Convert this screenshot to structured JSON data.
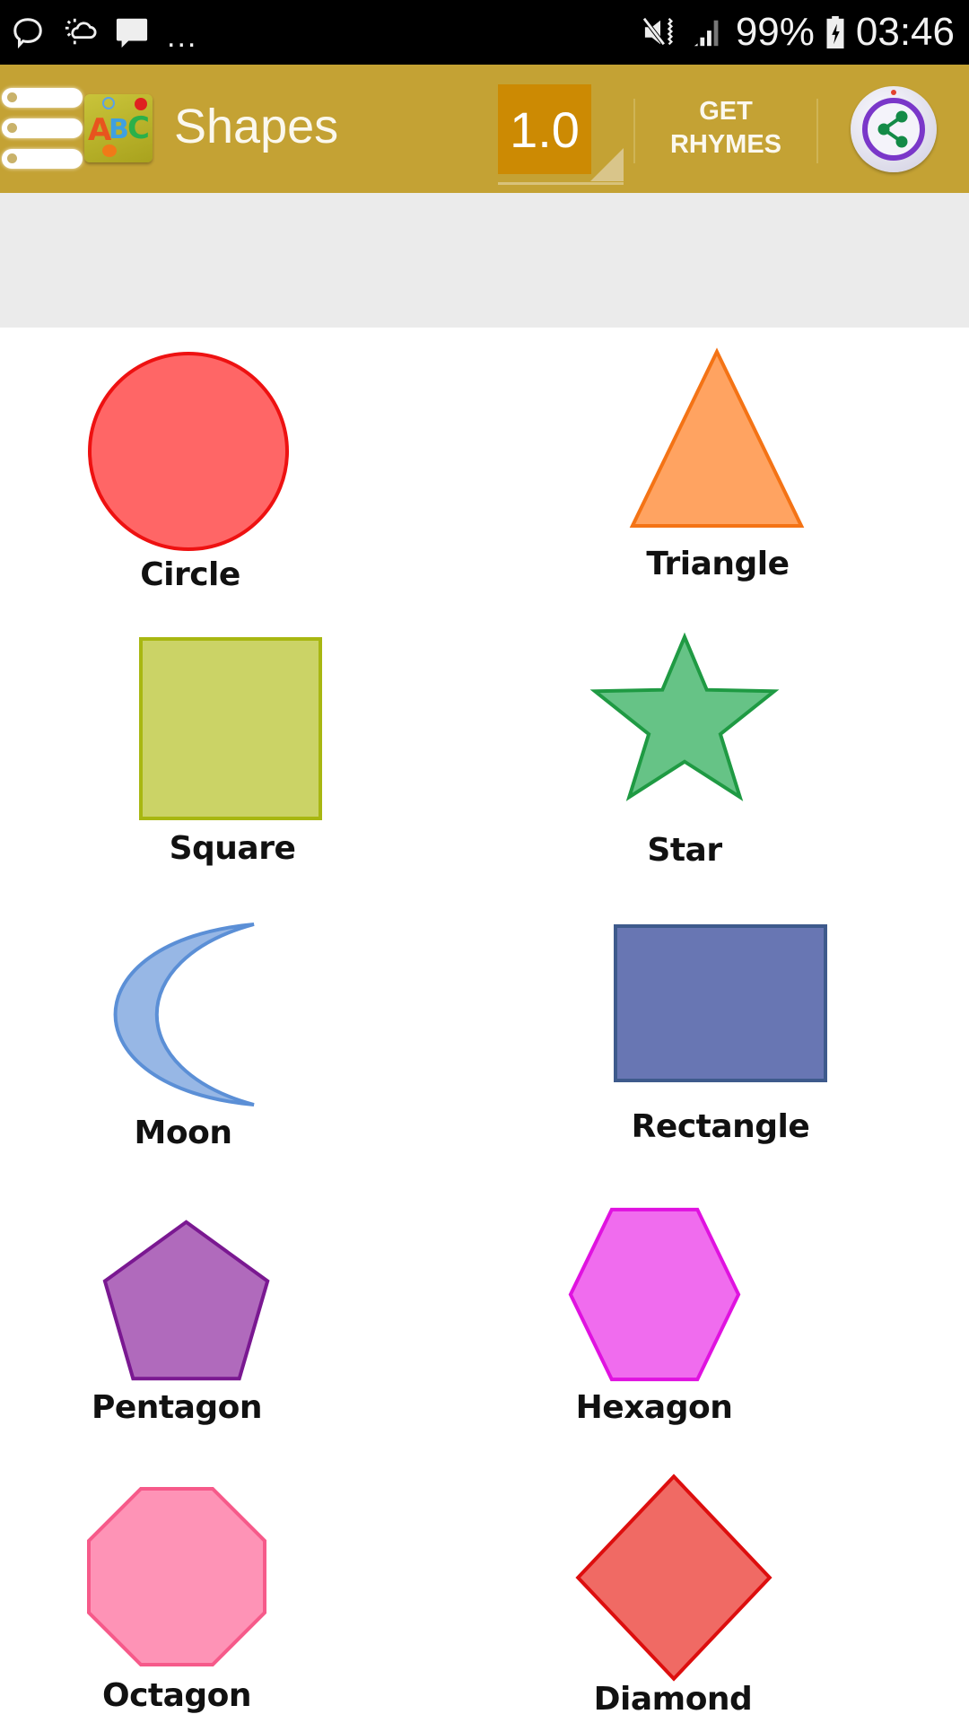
{
  "status_bar": {
    "left_icons": [
      "chat-bubble-outline-icon",
      "weather-partly-cloudy-icon",
      "message-icon"
    ],
    "more_indicator": "...",
    "right_icons": [
      "mute-vibrate-icon",
      "signal-strength-icon"
    ],
    "battery_percent": "99%",
    "battery_icon": "battery-charging-icon",
    "time": "03:46"
  },
  "app_bar": {
    "menu_icon": "menu-icon",
    "logo_icon": "abc-app-logo-icon",
    "logo_letters": [
      "A",
      "B",
      "C"
    ],
    "title": "Shapes",
    "speed_value": "1.0",
    "get_rhymes_line1": "GET",
    "get_rhymes_line2": "RHYMES",
    "share_icon": "share-icon",
    "colors": {
      "background": "#c4a234",
      "speed_box": "#cc8a03",
      "share_ring": "#7a37c9",
      "share_glyph": "#138a47"
    }
  },
  "ad_band": {
    "color": "#ebebeb"
  },
  "shapes": [
    {
      "label": "Circle",
      "type": "circle",
      "fill": "#ff6666",
      "stroke": "#ee1111"
    },
    {
      "label": "Triangle",
      "type": "triangle",
      "fill": "#ffa361",
      "stroke": "#f47315"
    },
    {
      "label": "Square",
      "type": "square",
      "fill": "#cbd366",
      "stroke": "#a8b711"
    },
    {
      "label": "Star",
      "type": "star",
      "fill": "#66c386",
      "stroke": "#1f9a43"
    },
    {
      "label": "Moon",
      "type": "moon",
      "fill": "#97b7e5",
      "stroke": "#5b8fd6"
    },
    {
      "label": "Rectangle",
      "type": "rectangle",
      "fill": "#6876b3",
      "stroke": "#3e5a8c"
    },
    {
      "label": "Pentagon",
      "type": "pentagon",
      "fill": "#b06abc",
      "stroke": "#7a1891"
    },
    {
      "label": "Hexagon",
      "type": "hexagon",
      "fill": "#f06cee",
      "stroke": "#e012e0"
    },
    {
      "label": "Octagon",
      "type": "octagon",
      "fill": "#fe93b6",
      "stroke": "#f65a8a"
    },
    {
      "label": "Diamond",
      "type": "diamond",
      "fill": "#f06a64",
      "stroke": "#dd0e0e"
    }
  ]
}
